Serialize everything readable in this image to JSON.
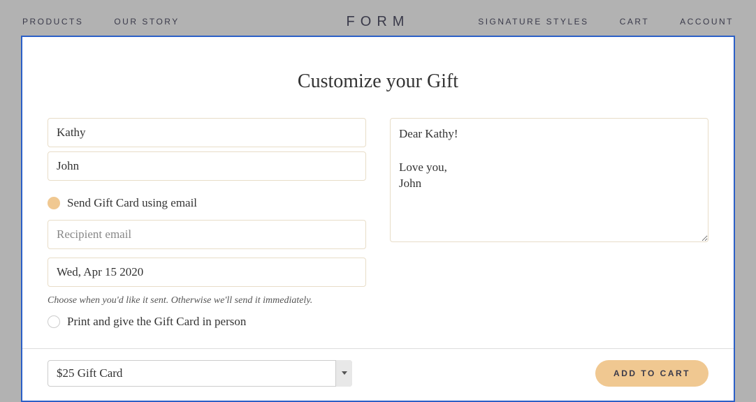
{
  "nav": {
    "left": [
      "PRODUCTS",
      "OUR STORY"
    ],
    "right": [
      "SIGNATURE STYLES",
      "CART",
      "ACCOUNT"
    ],
    "logo": "FORM"
  },
  "modal": {
    "title": "Customize your Gift",
    "recipient_name_value": "Kathy",
    "sender_name_value": "John",
    "radio_email_label": "Send Gift Card using email",
    "recipient_email_placeholder": "Recipient email",
    "recipient_email_value": "",
    "date_value": "Wed, Apr 15 2020",
    "date_helper": "Choose when you'd like it sent. Otherwise we'll send it immediately.",
    "radio_print_label": "Print and give the Gift Card in person",
    "message_value": "Dear Kathy!\n\nLove you,\nJohn",
    "select_value": "$25 Gift Card",
    "add_button": "ADD TO CART"
  }
}
